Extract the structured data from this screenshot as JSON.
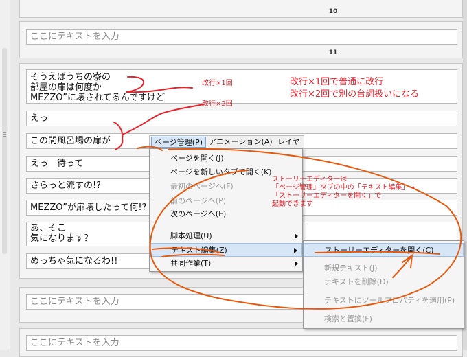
{
  "page_numbers": {
    "p10": "10",
    "p11": "11"
  },
  "placeholder": "ここにテキストを入力",
  "lines": {
    "l1": [
      "そうえばうちの寮の",
      "部屋の扉は何度か",
      "MEZZO”に壊されてるんですけど"
    ],
    "l2": "えっ",
    "l3": "この間風呂場の扉が",
    "l4": "えっ　待って",
    "l5": "さらっと流すの!?",
    "l6": "MEZZO”が扉壊したって何!?",
    "l7": [
      "あ、そこ",
      "気になります？"
    ],
    "l8": "めっちゃ気になるわ!!"
  },
  "menubar": {
    "page_manage": "ページ管理(P)",
    "animation": "アニメーション(A)",
    "layer": "レイヤー"
  },
  "page_menu": {
    "open_page": "ページを開く(J)",
    "open_new_tab": "ページを新しいタブで開く(K)",
    "first_page": "最初のページへ(F)",
    "prev_page": "前のページへ(P)",
    "next_page": "次のページへ(E)",
    "script_process": "脚本処理(U)",
    "text_edit": "テキスト編集(Z)",
    "collab": "共同作業(T)"
  },
  "text_edit_menu": {
    "open_story_editor": "ストーリーエディターを開く(C)",
    "new_text": "新規テキスト(J)",
    "delete_text": "テキストを削除(D)",
    "apply_tool_property": "テキストにツールプロパティを適用(P)",
    "find_replace": "検索と置換(F)"
  },
  "annotations": {
    "newline1": "改行×1回",
    "newline2": "改行×2回",
    "explain1": "改行×1回で普通に改行",
    "explain2": "改行×2回で別の台詞扱いになる",
    "story_note": [
      "ストーリーエディターは",
      "「ページ管理」タブの中の「テキスト編集」→",
      "「ストーリーエディターを開く」で",
      "起動できます"
    ]
  },
  "colors": {
    "annotation_red": "#e8222b",
    "annotation_orange": "#e8590c",
    "menu_highlight": "#d6e6f7"
  }
}
